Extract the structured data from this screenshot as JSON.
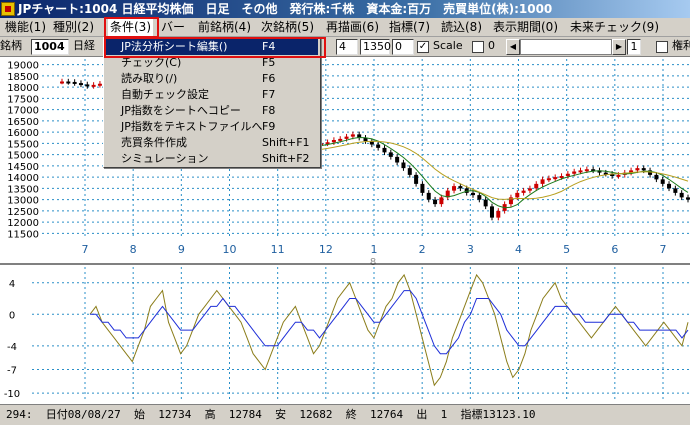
{
  "window": {
    "title": "JPチャート:1004 日経平均株価　日足　その他　発行株:千株　資本金:百万　売買単位(株):1000"
  },
  "menu": [
    "機能(1)",
    "種別(2)",
    "条件(3)",
    "バー",
    "前銘柄(4)",
    "次銘柄(5)",
    "再描画(6)",
    "指標(7)",
    "読込(8)",
    "表示期間(0)",
    "未来チェック(9)"
  ],
  "toolbar": {
    "ticker_label": "銘柄",
    "code": "1004",
    "name": "日経",
    "f1": "4",
    "f2": "1350",
    "f3": "0",
    "scale_label": "Scale",
    "scale_checked": "✓",
    "zero_label": "0",
    "zero_checked": "",
    "spin_value": "1",
    "right_label": "権利"
  },
  "dropdown": {
    "items": [
      {
        "label": "JP法分析シート編集()",
        "shortcut": "F4"
      },
      {
        "label": "チェック(C)",
        "shortcut": "F5"
      },
      {
        "label": "読み取り(/)",
        "shortcut": "F6"
      },
      {
        "label": "自動チェック設定",
        "shortcut": "F7"
      },
      {
        "label": "JP指数をシートへコピー",
        "shortcut": "F8"
      },
      {
        "label": "JP指数をテキストファイルへ",
        "shortcut": "F9"
      },
      {
        "label": "売買条件作成",
        "shortcut": "Shift+F1"
      },
      {
        "label": "シミュレーション",
        "shortcut": "Shift+F2"
      }
    ]
  },
  "chart_data": {
    "type": "line",
    "price_axis": {
      "ticks": [
        19000,
        18500,
        18000,
        17500,
        17000,
        16500,
        16000,
        15500,
        15000,
        14500,
        14000,
        13500,
        13000,
        12500,
        12000,
        11500
      ],
      "ylim": [
        11250,
        19250
      ]
    },
    "x_ticks": [
      "7",
      "8",
      "9",
      "10",
      "11",
      "12",
      "1",
      "2",
      "3",
      "4",
      "5",
      "6",
      "7"
    ],
    "period_label": "8",
    "oscillator_axis": {
      "ticks": [
        "4",
        "0",
        "-4",
        "-7",
        "-10"
      ],
      "ylim": [
        -11,
        6
      ]
    },
    "price_series": {
      "name": "",
      "values": [
        18250,
        18230,
        18180,
        18120,
        18050,
        18100,
        18150,
        18180,
        18200,
        18210,
        16500,
        16300,
        16100,
        15950,
        15850,
        15750,
        15700,
        15650,
        15600,
        15500,
        15450,
        15400,
        15350,
        15280,
        15200,
        15150,
        15100,
        15080,
        15050,
        15030,
        15000,
        15010,
        15050,
        15100,
        15150,
        15200,
        15250,
        15300,
        15350,
        15400,
        15450,
        15500,
        15550,
        15650,
        15700,
        15800,
        15900,
        15750,
        15600,
        15450,
        15300,
        15100,
        14900,
        14650,
        14400,
        14100,
        13700,
        13300,
        13000,
        12800,
        13100,
        13400,
        13600,
        13500,
        13300,
        13200,
        13000,
        12700,
        12200,
        12500,
        12800,
        13100,
        13300,
        13400,
        13500,
        13700,
        13900,
        13950,
        14000,
        14050,
        14150,
        14250,
        14300,
        14350,
        14300,
        14200,
        14150,
        14050,
        14100,
        14200,
        14300,
        14400,
        14300,
        14100,
        13900,
        13700,
        13500,
        13300,
        13100,
        13000
      ]
    },
    "oscillator_series": {
      "name": "",
      "values": [
        0,
        1,
        -1,
        -2,
        -3,
        -4,
        -5,
        -6,
        -4,
        -2,
        1,
        2,
        3,
        -1,
        -3,
        -5,
        -4,
        -2,
        0,
        1,
        2,
        3,
        2,
        1,
        0,
        -1,
        -3,
        -5,
        -6,
        -7,
        -5,
        -3,
        -1,
        0,
        1,
        -1,
        -3,
        -5,
        -4,
        -2,
        0,
        2,
        3,
        4,
        2,
        0,
        -2,
        -3,
        -1,
        1,
        2,
        4,
        5,
        3,
        0,
        -3,
        -6,
        -9,
        -8,
        -6,
        -3,
        -1,
        1,
        3,
        5,
        4,
        2,
        0,
        -3,
        -6,
        -8,
        -7,
        -5,
        -2,
        0,
        2,
        3,
        4,
        2,
        1,
        0,
        -1,
        -2,
        -3,
        -2,
        -1,
        0,
        1,
        0,
        -1,
        -2,
        -3,
        -4,
        -3,
        -2,
        -1,
        -2,
        -3,
        -4,
        -1
      ]
    },
    "oscillator_avg": {
      "name": "",
      "values": [
        0,
        0,
        -1,
        -1,
        -2,
        -2,
        -3,
        -3,
        -3,
        -2,
        -1,
        0,
        1,
        0,
        -1,
        -2,
        -2,
        -2,
        -1,
        0,
        1,
        1,
        2,
        1,
        1,
        0,
        -1,
        -2,
        -3,
        -4,
        -4,
        -4,
        -3,
        -2,
        -1,
        -1,
        -2,
        -2,
        -3,
        -2,
        -1,
        0,
        1,
        2,
        2,
        1,
        0,
        -1,
        -1,
        0,
        1,
        2,
        3,
        3,
        2,
        0,
        -2,
        -4,
        -5,
        -5,
        -4,
        -3,
        -1,
        0,
        2,
        2,
        2,
        1,
        0,
        -2,
        -3,
        -4,
        -4,
        -3,
        -2,
        -1,
        0,
        1,
        1,
        1,
        0,
        0,
        -1,
        -1,
        -1,
        -1,
        0,
        0,
        0,
        -1,
        -1,
        -2,
        -2,
        -2,
        -2,
        -2,
        -2,
        -2,
        -3,
        -2
      ]
    },
    "colors": {
      "grid": "#2a8fc8",
      "oscillator": "#8b7d1a",
      "average": "#1f2fd8",
      "bull": "#cc0000",
      "bear": "#000000",
      "ma_short": "#1a7a1a",
      "ma_long": "#b8a020"
    }
  },
  "status": {
    "text": "294:  日付08/08/27  始  12734  高  12784  安  12682  終  12764  出  1  指標13123.10"
  }
}
